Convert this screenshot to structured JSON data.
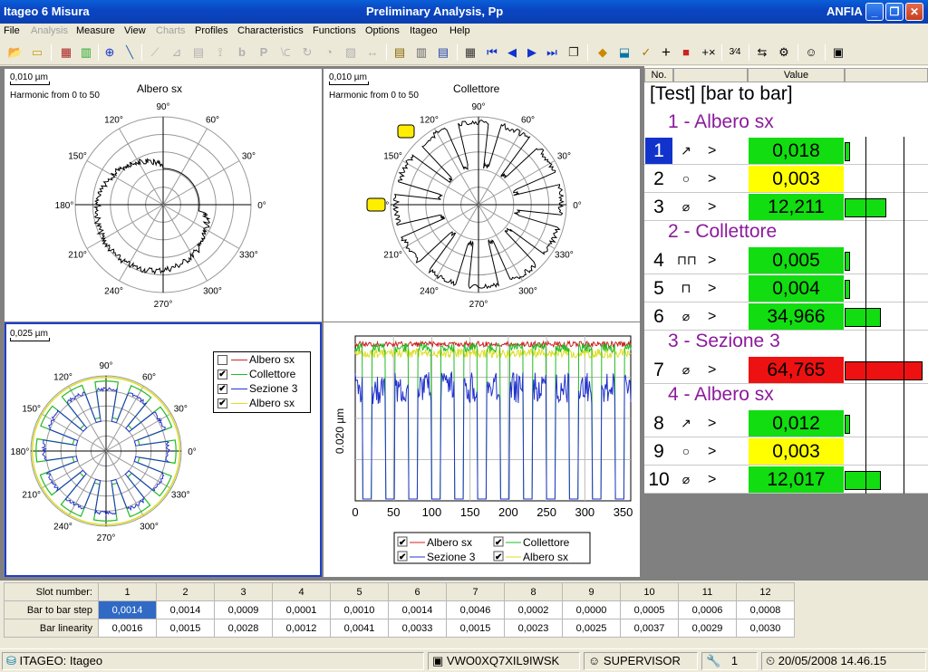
{
  "window": {
    "app_title": "Itageo 6 Misura",
    "doc_title": "Preliminary Analysis, Pp",
    "right_label": "ANFIA"
  },
  "menu": [
    {
      "label": "File",
      "enabled": true
    },
    {
      "label": "Analysis",
      "enabled": false
    },
    {
      "label": "Measure",
      "enabled": true
    },
    {
      "label": "View",
      "enabled": true
    },
    {
      "label": "Charts",
      "enabled": false
    },
    {
      "label": "Profiles",
      "enabled": true
    },
    {
      "label": "Characteristics",
      "enabled": true
    },
    {
      "label": "Functions",
      "enabled": true
    },
    {
      "label": "Options",
      "enabled": true
    },
    {
      "label": "Itageo",
      "enabled": true
    },
    {
      "label": "Help",
      "enabled": true
    }
  ],
  "toolbar": {
    "icons": [
      "open-folder",
      "folder",
      "chart-settings",
      "grid-chart",
      "target",
      "pen",
      "line-chart",
      "scatter",
      "bar-chart",
      "tree",
      "b",
      "p",
      "trend",
      "sync",
      "tune",
      "align",
      "list",
      "notes",
      "notes2",
      "calendar",
      "first",
      "prev",
      "next",
      "last",
      "copy",
      "warning",
      "export",
      "check-list",
      "crosshair",
      "record",
      "plus-x",
      "sort-numbers",
      "sort-alt",
      "settings-wrench",
      "person",
      "monitor"
    ],
    "glyphs": {
      "b": "b",
      "p": "P",
      "plus_x": "+×",
      "sort_numbers": "3⁄4"
    }
  },
  "polar_top_left": {
    "scale": "0,010 µm",
    "subtitle": "Harmonic from 0 to 50",
    "title": "Albero sx",
    "angle_labels": [
      "90°",
      "60°",
      "30°",
      "0°",
      "330°",
      "300°",
      "270°",
      "240°",
      "210°",
      "180°",
      "150°",
      "120°"
    ]
  },
  "polar_top_mid": {
    "scale": "0,010 µm",
    "subtitle": "Harmonic from 0 to 50",
    "title": "Collettore",
    "angle_labels": [
      "90°",
      "60°",
      "30°",
      "0°",
      "330°",
      "300°",
      "270°",
      "240°",
      "210°",
      "180°",
      "150°",
      "120°"
    ]
  },
  "polar_bottom_left": {
    "scale": "0,025 µm",
    "angle_labels": [
      "90°",
      "60°",
      "30°",
      "0°",
      "330°",
      "300°",
      "270°",
      "240°",
      "210°",
      "180°",
      "150°",
      "120°"
    ],
    "legend": [
      {
        "label": "Albero sx",
        "checked": false,
        "color": "#cc2222"
      },
      {
        "label": "Collettore",
        "checked": true,
        "color": "#22bb22"
      },
      {
        "label": "Sezione 3",
        "checked": true,
        "color": "#2233cc"
      },
      {
        "label": "Albero sx",
        "checked": true,
        "color": "#dddd22"
      }
    ]
  },
  "chart_data": {
    "type": "line",
    "ylabel": "0.020 µm",
    "xlim": [
      0,
      360
    ],
    "x_ticks": [
      "0",
      "50",
      "100",
      "150",
      "200",
      "250",
      "300",
      "350"
    ],
    "legend": [
      {
        "label": "Albero sx",
        "checked": true,
        "color": "#cc2222"
      },
      {
        "label": "Collettore",
        "checked": true,
        "color": "#22bb22"
      },
      {
        "label": "Sezione 3",
        "checked": true,
        "color": "#2233cc"
      },
      {
        "label": "Albero sx",
        "checked": true,
        "color": "#dddd22"
      }
    ]
  },
  "results": {
    "col_no": "No.",
    "col_value": "Value",
    "title": "[Test] [bar to bar]",
    "groups": [
      {
        "label": "1 - Albero sx",
        "rows": [
          {
            "no": "1",
            "sym": "↗",
            "cmp": ">",
            "value": "0,018",
            "status": "#11dd11",
            "bar": 0.07,
            "selected": true
          },
          {
            "no": "2",
            "sym": "○",
            "cmp": ">",
            "value": "0,003",
            "status": "#ffff00",
            "bar": 0,
            "selected": false
          },
          {
            "no": "3",
            "sym": "⌀",
            "cmp": ">",
            "value": "12,211",
            "status": "#11dd11",
            "bar": 0.53,
            "selected": false
          }
        ]
      },
      {
        "label": "2 - Collettore",
        "rows": [
          {
            "no": "4",
            "sym": "⊓⊓",
            "cmp": ">",
            "value": "0,005",
            "status": "#11dd11",
            "bar": 0.03,
            "selected": false
          },
          {
            "no": "5",
            "sym": "⊓",
            "cmp": ">",
            "value": "0,004",
            "status": "#11dd11",
            "bar": 0.03,
            "selected": false
          },
          {
            "no": "6",
            "sym": "⌀",
            "cmp": ">",
            "value": "34,966",
            "status": "#11dd11",
            "bar": 0.47,
            "selected": false
          }
        ]
      },
      {
        "label": "3 - Sezione 3",
        "rows": [
          {
            "no": "7",
            "sym": "⌀",
            "cmp": ">",
            "value": "64,765",
            "status": "#ee1111",
            "bar": 1.0,
            "selected": false
          }
        ]
      },
      {
        "label": "4 - Albero sx",
        "rows": [
          {
            "no": "8",
            "sym": "↗",
            "cmp": ">",
            "value": "0,012",
            "status": "#11dd11",
            "bar": 0.05,
            "selected": false
          },
          {
            "no": "9",
            "sym": "○",
            "cmp": ">",
            "value": "0,003",
            "status": "#ffff00",
            "bar": 0,
            "selected": false
          },
          {
            "no": "10",
            "sym": "⌀",
            "cmp": ">",
            "value": "12,017",
            "status": "#11dd11",
            "bar": 0.47,
            "selected": false
          }
        ]
      }
    ]
  },
  "slots": {
    "label_slot": "Slot number:",
    "label_step": "Bar to bar step",
    "label_lin": "Bar linearity",
    "numbers": [
      "1",
      "2",
      "3",
      "4",
      "5",
      "6",
      "7",
      "8",
      "9",
      "10",
      "11",
      "12"
    ],
    "step": [
      "0,0014",
      "0,0014",
      "0,0009",
      "0,0001",
      "0,0010",
      "0,0014",
      "0,0046",
      "0,0002",
      "0,0000",
      "0,0005",
      "0,0006",
      "0,0008"
    ],
    "linearity": [
      "0,0016",
      "0,0015",
      "0,0028",
      "0,0012",
      "0,0041",
      "0,0033",
      "0,0015",
      "0,0023",
      "0,0025",
      "0,0037",
      "0,0029",
      "0,0030"
    ]
  },
  "status": {
    "db": "ITAGEO: Itageo",
    "machine": "VWO0XQ7XIL9IWSK",
    "user": "SUPERVISOR",
    "count": "1",
    "datetime": "20/05/2008 14.46.15"
  }
}
